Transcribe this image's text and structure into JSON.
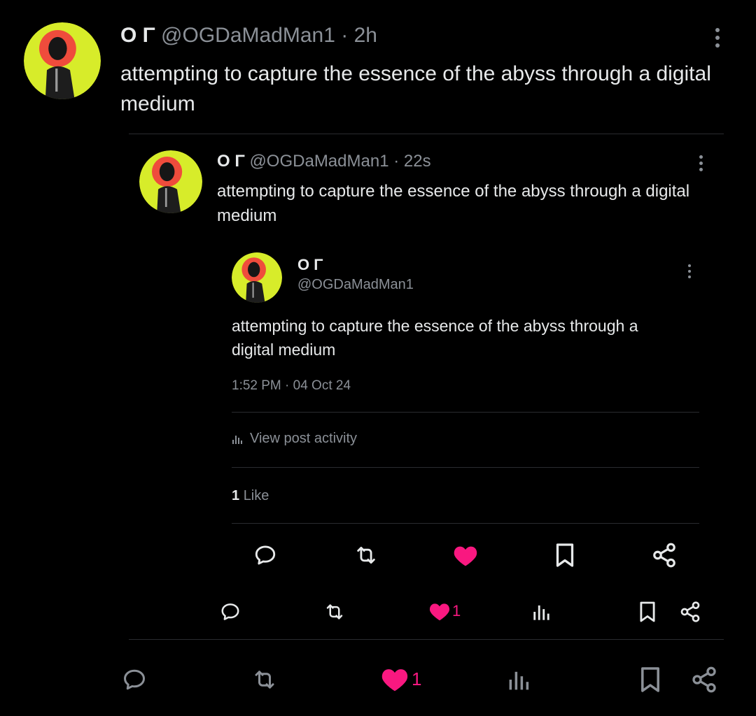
{
  "outer": {
    "display_name": "O Γ",
    "handle": "@OGDaMadMan1",
    "time": "· 2h",
    "text": "attempting to capture the essence of the abyss through a digital medium",
    "like_count": "1"
  },
  "middle": {
    "display_name": "O Γ",
    "handle": "@OGDaMadMan1",
    "time": "· 22s",
    "text": "attempting to capture the essence of the abyss through a digital medium",
    "like_count": "1"
  },
  "inner": {
    "display_name": "O Γ",
    "handle": "@OGDaMadMan1",
    "text": "attempting to capture the essence of the abyss through a digital medium",
    "timestamp": "1:52 PM · 04 Oct 24",
    "activity_label": "View post activity",
    "likes_count": "1",
    "likes_label": "Like"
  },
  "colors": {
    "background": "#000000",
    "text": "#e7e9ea",
    "muted": "#8b9097",
    "like": "#f91880",
    "avatar_ring": "#d7ec2a",
    "avatar_sun": "#ef4c3c"
  },
  "icons": [
    "more-icon",
    "reply-icon",
    "retweet-icon",
    "heart-icon",
    "views-icon",
    "bookmark-icon",
    "share-icon"
  ]
}
